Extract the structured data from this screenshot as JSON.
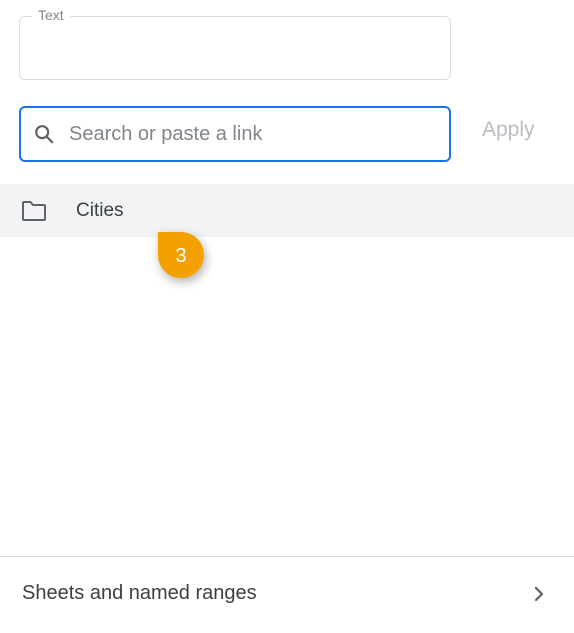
{
  "text_field": {
    "label": "Text",
    "value": ""
  },
  "search": {
    "placeholder": "Search or paste a link",
    "value": ""
  },
  "apply": {
    "label": "Apply"
  },
  "results": [
    {
      "label": "Cities",
      "icon": "sheet-tab-icon"
    }
  ],
  "annotation": {
    "number": "3"
  },
  "footer": {
    "label": "Sheets and named ranges"
  }
}
